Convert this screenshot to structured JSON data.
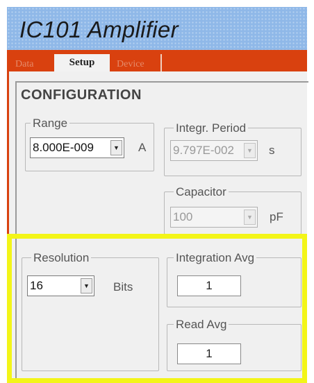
{
  "app": {
    "title": "IC101 Amplifier"
  },
  "tabs": {
    "data": "Data",
    "setup": "Setup",
    "device": "Device"
  },
  "config": {
    "title": "CONFIGURATION",
    "range": {
      "label": "Range",
      "value": "8.000E-009",
      "unit": "A"
    },
    "integration_period": {
      "label": "Integr.  Period",
      "value": "9.797E-002",
      "unit": "s"
    },
    "capacitor": {
      "label": "Capacitor",
      "value": "100",
      "unit": "pF"
    },
    "resolution": {
      "label": "Resolution",
      "value": "16",
      "unit": "Bits"
    },
    "integration_avg": {
      "label": "Integration Avg",
      "value": "1"
    },
    "read_avg": {
      "label": "Read Avg",
      "value": "1"
    }
  },
  "colors": {
    "title_bar": "#8fb8e8",
    "tab_strip": "#d9410f",
    "highlight": "#f3f518",
    "panel": "#f0f0f0"
  },
  "icons": {
    "dropdown_arrow": "▼"
  }
}
